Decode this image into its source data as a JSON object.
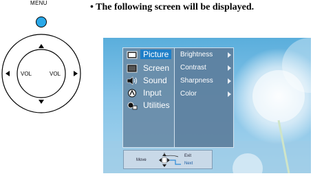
{
  "remote": {
    "menu_label": "MENU",
    "vol_left": "VOL",
    "vol_right": "VOL"
  },
  "instruction": "• The following screen will be displayed.",
  "osd": {
    "main_menu": [
      {
        "label": "Picture",
        "icon": "picture-icon",
        "selected": true
      },
      {
        "label": "Screen",
        "icon": "screen-icon",
        "selected": false
      },
      {
        "label": "Sound",
        "icon": "sound-icon",
        "selected": false
      },
      {
        "label": "Input",
        "icon": "input-icon",
        "selected": false
      },
      {
        "label": "Utilities",
        "icon": "utilities-icon",
        "selected": false
      }
    ],
    "sub_menu": [
      "Brightness",
      "Contrast",
      "Sharpness",
      "Color"
    ],
    "nav": {
      "move": "Move",
      "exit": "Exit",
      "next": "Next"
    }
  },
  "colors": {
    "menu_button": "#2aa8e8",
    "selected_highlight": "#1f7fc8",
    "osd_panel": "#6a8ca8",
    "sky": "#6cb8e2"
  }
}
